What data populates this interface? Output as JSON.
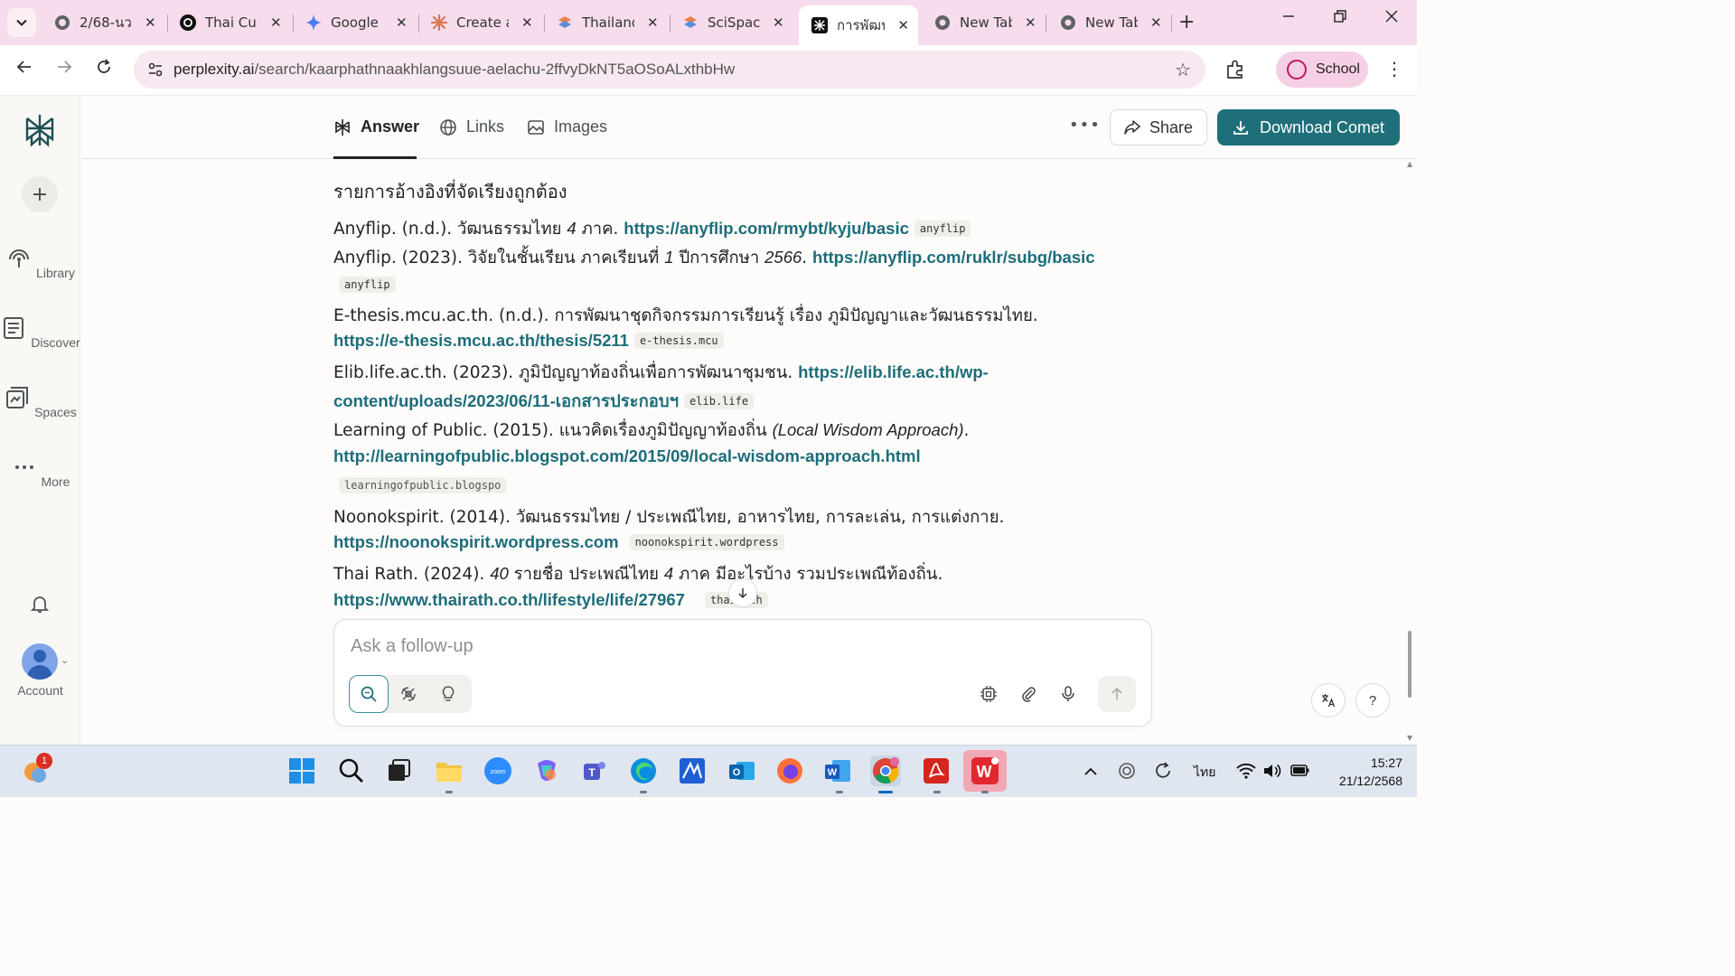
{
  "browser": {
    "tabs": [
      {
        "title": "2/68-นว",
        "icon": "globe-icon",
        "active": false
      },
      {
        "title": "Thai Cul",
        "icon": "threads-icon",
        "active": false
      },
      {
        "title": "Google",
        "icon": "gemini-icon",
        "active": false
      },
      {
        "title": "Create a",
        "icon": "claude-icon",
        "active": false
      },
      {
        "title": "Thailand",
        "icon": "stack-icon",
        "active": false
      },
      {
        "title": "SciSpace",
        "icon": "scispace-icon",
        "active": false
      },
      {
        "title": "การพัฒน",
        "icon": "perplexity-icon",
        "active": true
      },
      {
        "title": "New Tab",
        "icon": "chrome-icon",
        "active": false
      },
      {
        "title": "New Tab",
        "icon": "chrome-icon",
        "active": false
      }
    ],
    "url_domain": "perplexity.ai",
    "url_path": "/search/kaarphathnaakhlangsuue-aelachu-2ffvyDkNT5aOSoALxthbHw",
    "profile_label": "School"
  },
  "rail": {
    "library": "Library",
    "discover": "Discover",
    "spaces": "Spaces",
    "more": "More",
    "account": "Account"
  },
  "header": {
    "tab_answer": "Answer",
    "tab_links": "Links",
    "tab_images": "Images",
    "share": "Share",
    "download": "Download Comet"
  },
  "answer": {
    "heading": "รายการอ้างอิงที่จัดเรียงถูกต้อง",
    "refs": [
      {
        "pre": "Anyflip. (n.d.). วัฒนธรรมไทย ",
        "num": "4",
        "post": " ภาค. ",
        "url": "https://anyflip.com/rmybt/kyju/basic",
        "chip": "anyflip"
      },
      {
        "pre": "Anyflip. (2023). วิจัยในชั้นเรียน ภาคเรียนที่ ",
        "num": "1",
        "mid": " ปีการศึกษา ",
        "num2": "2566",
        "post": ". ",
        "url": "https://anyflip.com/ruklr/subg/basic",
        "chip": "anyflip"
      },
      {
        "pre": "E-thesis.mcu.ac.th. (n.d.). การพัฒนาชุดกิจกรรมการเรียนรู้ เรื่อง ภูมิปัญญาและวัฒนธรรมไทย.",
        "url": "https://e-thesis.mcu.ac.th/thesis/5211",
        "chip": "e-thesis.mcu"
      },
      {
        "pre": "Elib.life.ac.th. (2023). ภูมิปัญญาท้องถิ่นเพื่อการพัฒนาชุมชน. ",
        "url": "https://elib.life.ac.th/wp-",
        "url2": "content/uploads/2023/06/11-เอกสารประกอบฯ",
        "chip": "elib.life"
      },
      {
        "pre": "Learning of Public. (2015). แนวคิดเรื่องภูมิปัญญาท้องถิ่น ",
        "ital": "(Local Wisdom Approach)",
        "post": ".",
        "url": "http://learningofpublic.blogspot.com/2015/09/local-wisdom-approach.html",
        "chip": "learningofpublic.blogspo"
      },
      {
        "pre": "Noonokspirit. (2014). วัฒนธรรมไทย / ประเพณีไทย, อาหารไทย, การละเล่น, การแต่งกาย.",
        "url": "https://noonokspirit.wordpress.com",
        "chip": "noonokspirit.wordpress"
      },
      {
        "pre": "Thai Rath. (2024). ",
        "num": "40",
        "mid": " รายชื่อ ประเพณีไทย ",
        "num2": "4",
        "post": " ภาค มีอะไรบ้าง รวมประเพณีท้องถิ่น.",
        "url": "https://www.thairath.co.th/lifestyle/life/27967",
        "chip": "thairath"
      }
    ]
  },
  "followup": {
    "placeholder": "Ask a follow-up"
  },
  "taskbar": {
    "notif_count": "1",
    "lang": "ไทย",
    "time": "15:27",
    "date": "21/12/2568"
  },
  "colors": {
    "accent": "#1f6f7a",
    "link": "#1d6d7a",
    "tabstrip": "#f6dcec"
  }
}
